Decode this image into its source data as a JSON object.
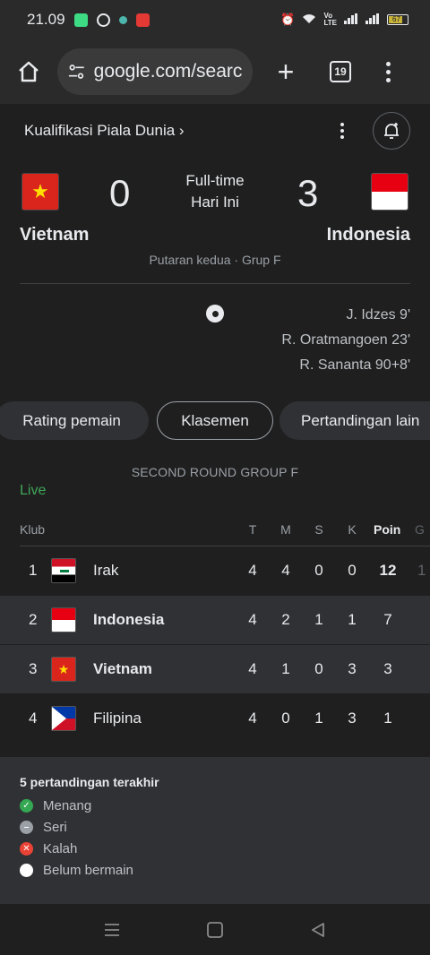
{
  "status_bar": {
    "time": "21.09",
    "battery": "67"
  },
  "browser": {
    "url": "google.com/search",
    "tab_count": "19"
  },
  "header": {
    "competition": "Kualifikasi Piala Dunia ›"
  },
  "match": {
    "home": {
      "name": "Vietnam",
      "score": "0"
    },
    "away": {
      "name": "Indonesia",
      "score": "3"
    },
    "status_line1": "Full-time",
    "status_line2": "Hari Ini",
    "round": "Putaran kedua · Grup F",
    "scorers": [
      "J. Idzes 9'",
      "R. Oratmangoen 23'",
      "R. Sananta 90+8'"
    ]
  },
  "chips": [
    "Rating pemain",
    "Klasemen",
    "Pertandingan lain"
  ],
  "standings": {
    "title": "SECOND ROUND GROUP F",
    "live": "Live",
    "headers": {
      "club": "Klub",
      "t": "T",
      "m": "M",
      "s": "S",
      "k": "K",
      "poin": "Poin",
      "g": "G"
    },
    "rows": [
      {
        "rank": "1",
        "club": "Irak",
        "t": "4",
        "m": "4",
        "s": "0",
        "k": "0",
        "poin": "12",
        "g": "1"
      },
      {
        "rank": "2",
        "club": "Indonesia",
        "t": "4",
        "m": "2",
        "s": "1",
        "k": "1",
        "poin": "7",
        "g": ""
      },
      {
        "rank": "3",
        "club": "Vietnam",
        "t": "4",
        "m": "1",
        "s": "0",
        "k": "3",
        "poin": "3",
        "g": ""
      },
      {
        "rank": "4",
        "club": "Filipina",
        "t": "4",
        "m": "0",
        "s": "1",
        "k": "3",
        "poin": "1",
        "g": ""
      }
    ]
  },
  "legend": {
    "title": "5 pertandingan terakhir",
    "items": [
      {
        "label": "Menang",
        "color": "#34a853"
      },
      {
        "label": "Seri",
        "color": "#9aa0a6"
      },
      {
        "label": "Kalah",
        "color": "#ea4335"
      },
      {
        "label": "Belum bermain",
        "color": "#ffffff"
      }
    ]
  }
}
